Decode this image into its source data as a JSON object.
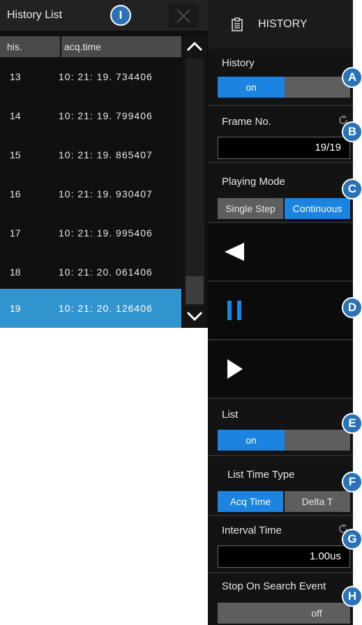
{
  "history_list": {
    "title": "History List",
    "callout": "I",
    "col_his": "his.",
    "col_time": "acq.time",
    "rows": [
      {
        "his": "13",
        "time": "10: 21: 19. 734406"
      },
      {
        "his": "14",
        "time": "10: 21: 19. 799406"
      },
      {
        "his": "15",
        "time": "10: 21: 19. 865407"
      },
      {
        "his": "16",
        "time": "10: 21: 19. 930407"
      },
      {
        "his": "17",
        "time": "10: 21: 19. 995406"
      },
      {
        "his": "18",
        "time": "10: 21: 20. 061406"
      },
      {
        "his": "19",
        "time": "10: 21: 20. 126406"
      }
    ],
    "selected_his": "19"
  },
  "menu": {
    "title": "HISTORY",
    "history": {
      "label": "History",
      "on": "on",
      "callout": "A"
    },
    "frame": {
      "label": "Frame No.",
      "value": "19/19",
      "callout": "B"
    },
    "playing": {
      "label": "Playing Mode",
      "opt1": "Single Step",
      "opt2": "Continuous",
      "active": "Continuous",
      "callout": "C"
    },
    "playback": {
      "callout": "D"
    },
    "list": {
      "label": "List",
      "on": "on",
      "callout": "E"
    },
    "list_time": {
      "label": "List Time Type",
      "opt1": "Acq Time",
      "opt2": "Delta T",
      "active": "Acq Time",
      "callout": "F"
    },
    "interval": {
      "label": "Interval Time",
      "value": "1.00us",
      "callout": "G"
    },
    "stop": {
      "label": "Stop On Search Event",
      "off": "off",
      "callout": "H"
    }
  },
  "colors": {
    "accent": "#1a84e0",
    "selected_row": "#3395d0",
    "callout": "#2a72b8"
  }
}
